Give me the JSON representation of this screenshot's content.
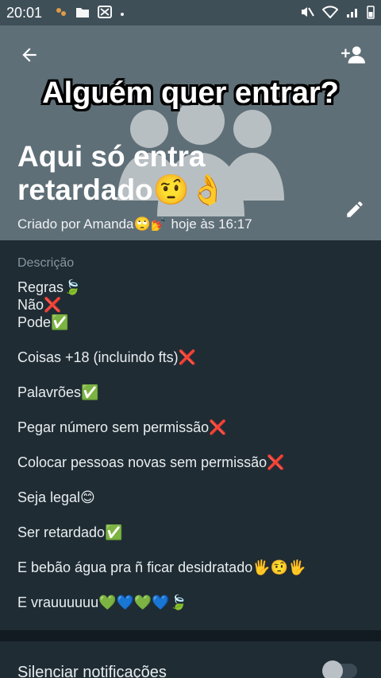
{
  "status_bar": {
    "time": "20:01",
    "left_icons": [
      "app-notification-icon",
      "folder-icon",
      "gallery-icon",
      "dot-icon"
    ],
    "right_icons": [
      "mute-icon",
      "wifi-icon",
      "signal-icon",
      "battery-icon"
    ]
  },
  "header": {
    "overlay_caption": "Alguém quer entrar?",
    "title": "Aqui só entra retardado🤨👌",
    "meta": "Criado por Amanda🙄💅 hoje às 16:17",
    "background_color": "#5f6f77"
  },
  "description": {
    "label": "Descrição",
    "lines": [
      "Regras🍃",
      "Não❌",
      "Pode✅",
      "",
      "Coisas +18 (incluindo fts)❌",
      "",
      "Palavrões✅",
      "",
      "Pegar número sem permissão❌",
      "",
      "Colocar pessoas novas sem permissão❌",
      "",
      "Seja legal😊",
      "",
      "Ser retardado✅",
      "",
      "E bebão água pra ñ ficar desidratado🖐🤨🖐",
      "",
      "E vrauuuuuu💚💙💚💙🍃"
    ]
  },
  "settings": {
    "mute_label": "Silenciar notificações",
    "mute_enabled": false
  }
}
